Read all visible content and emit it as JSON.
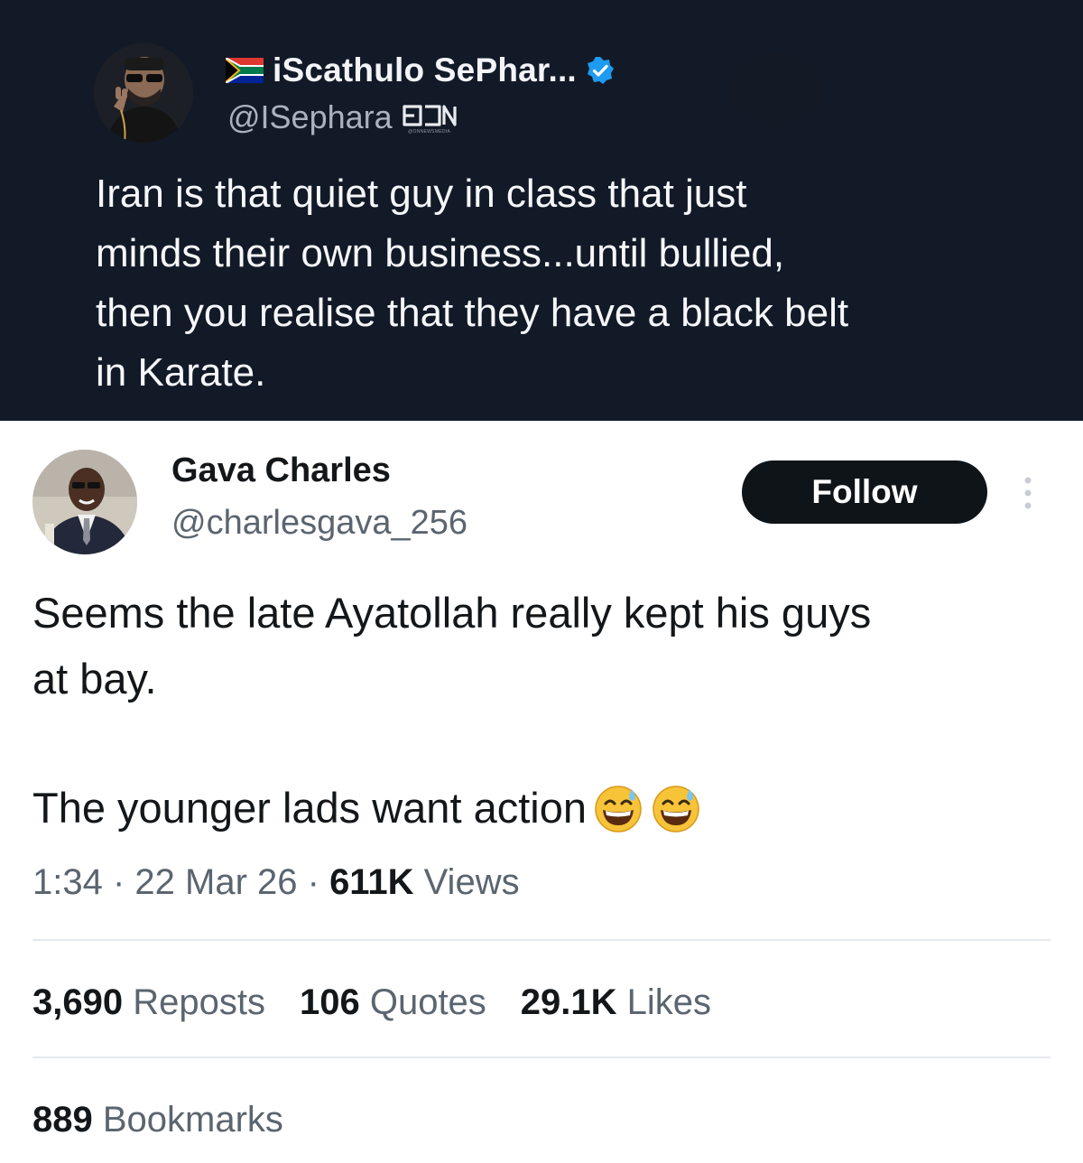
{
  "quoted_tweet": {
    "display_name": "iScathulo SePhar...",
    "handle": "@ISephara",
    "watermark": "@ONNEWSMEDIA",
    "text_lines": [
      "Iran is that quiet guy in class that just",
      "minds their own business...until bullied,",
      "then you realise that they have a black belt",
      "in Karate."
    ],
    "flag_icon": "south-africa-flag-icon",
    "verified_icon": "verified-badge-icon",
    "colors": {
      "background": "#121a28",
      "text": "#f5f7fa",
      "verified": "#1d9bf0"
    }
  },
  "tweet": {
    "display_name": "Gava Charles",
    "handle": "@charlesgava_256",
    "follow_label": "Follow",
    "more_icon": "more-vertical-icon",
    "text_lines": [
      "Seems the late Ayatollah really kept his guys",
      "at bay."
    ],
    "text_second_paragraph": "The younger lads want action",
    "emojis": [
      "grinning-sweat-emoji",
      "grinning-sweat-emoji"
    ],
    "meta": {
      "time": "1:34",
      "sep1": " · ",
      "date": "22 Mar 26",
      "sep2": " · ",
      "views_count": "611K",
      "views_label": " Views"
    },
    "stats": {
      "reposts_count": "3,690",
      "reposts_label": " Reposts",
      "quotes_count": "106",
      "quotes_label": " Quotes",
      "likes_count": "29.1K",
      "likes_label": " Likes",
      "bookmarks_count": "889",
      "bookmarks_label": " Bookmarks"
    },
    "colors": {
      "follow_bg": "#0f1419",
      "text": "#14171a",
      "secondary": "#5b6570"
    }
  }
}
